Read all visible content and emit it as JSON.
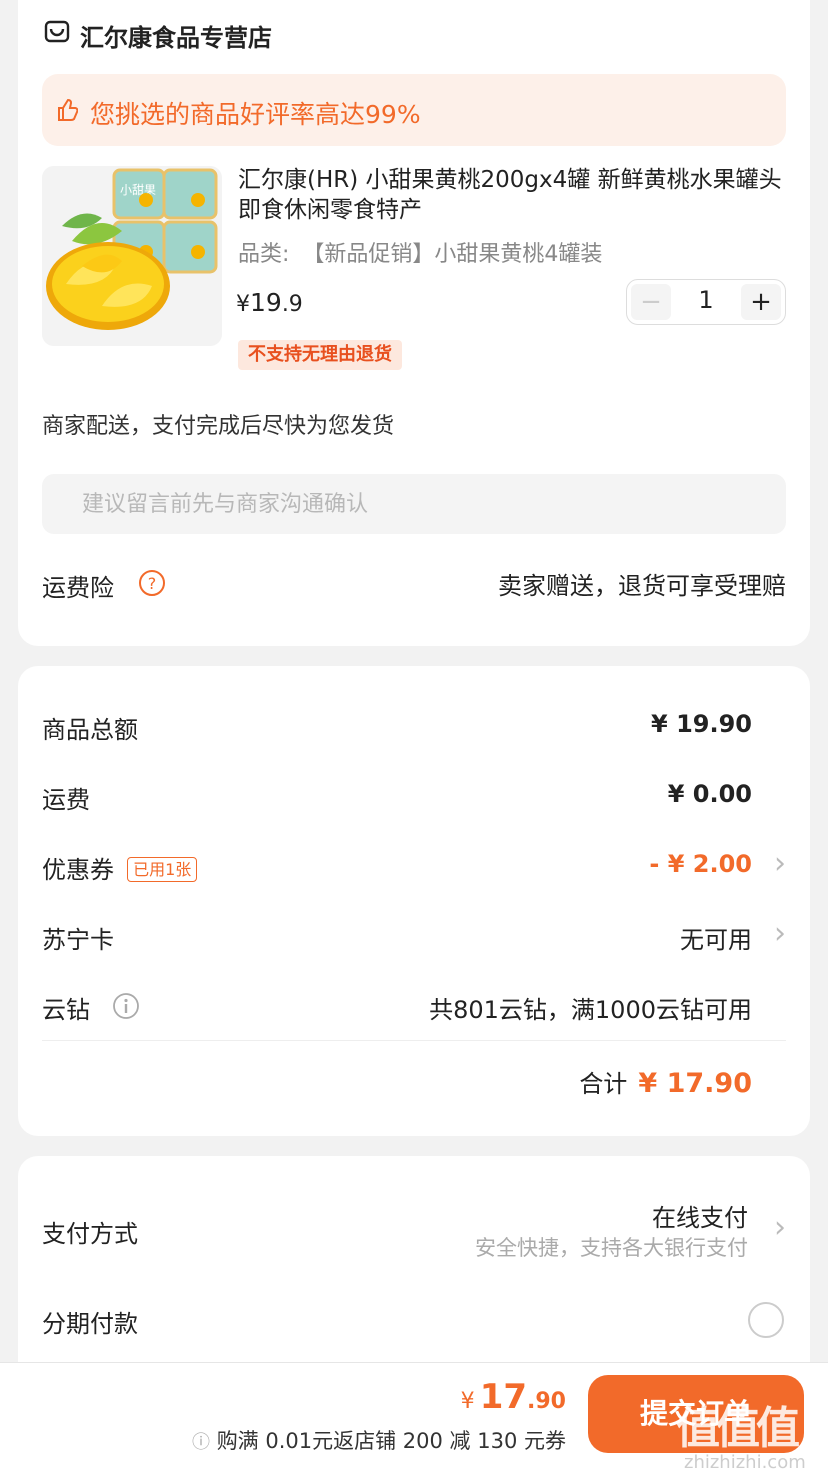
{
  "store": {
    "name": "汇尔康食品专营店",
    "icon": "store-icon"
  },
  "banner": {
    "text": "您挑选的商品好评率高达99%",
    "icon": "thumbs-up-icon"
  },
  "product": {
    "title": "汇尔康(HR) 小甜果黄桃200gx4罐 新鲜黄桃水果罐头即食休闲零食特产",
    "spec_label": "品类:",
    "spec_value": "【新品促销】小甜果黄桃4罐装",
    "price_symbol": "¥",
    "price_int": "19",
    "price_dec": ".9",
    "quantity": "1",
    "no_return_tag": "不支持无理由退货",
    "jar_label": "小甜果"
  },
  "shipping": {
    "text": "商家配送，支付完成后尽快为您发货"
  },
  "note": {
    "placeholder": "建议留言前先与商家沟通确认"
  },
  "insurance": {
    "label": "运费险",
    "value": "卖家赠送，退货可享受理赔"
  },
  "summary": {
    "goods_total_label": "商品总额",
    "goods_total_value": "¥ 19.90",
    "freight_label": "运费",
    "freight_value": "¥ 0.00",
    "coupon_label": "优惠券",
    "coupon_badge": "已用1张",
    "coupon_value": "- ¥ 2.00",
    "card_label": "苏宁卡",
    "card_value": "无可用",
    "diamond_label": "云钻",
    "diamond_value": "共801云钻，满1000云钻可用",
    "total_label": "合计",
    "total_value": "¥ 17.90"
  },
  "payment": {
    "method_label": "支付方式",
    "method_value": "在线支付",
    "method_sub": "安全快捷，支持各大银行支付",
    "installment_label": "分期付款"
  },
  "bottom": {
    "price_symbol": "¥",
    "price_int": "17",
    "price_dec": ".90",
    "promo": "购满 0.01元返店铺 200 减 130 元券",
    "submit_label": "提交订单"
  },
  "watermark": {
    "text": "值",
    "url": "zhizhizhi.com"
  },
  "colors": {
    "accent": "#f26a2a",
    "banner_bg": "#fdf0e9",
    "page_bg": "#f2f2f2"
  }
}
